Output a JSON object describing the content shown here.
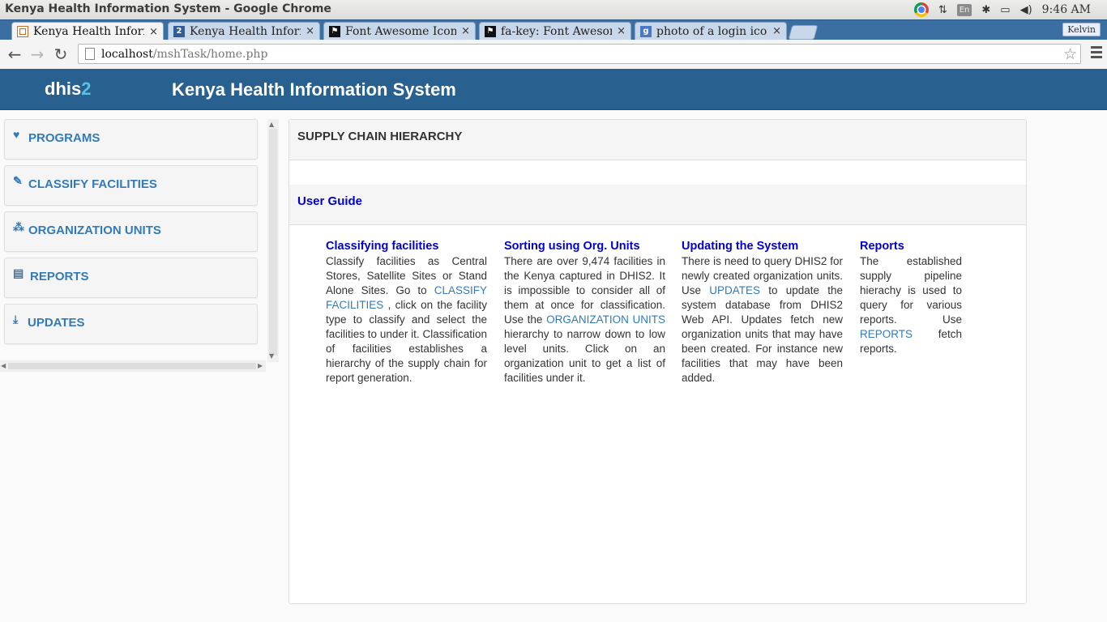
{
  "os": {
    "window_title": "Kenya Health Information System - Google Chrome",
    "lang": "En",
    "clock": "9:46 AM"
  },
  "browser": {
    "tabs": [
      {
        "label": "Kenya Health Informatio",
        "favicon": "dhis-icon",
        "active": true
      },
      {
        "label": "Kenya Health Informatio",
        "favicon": "dhis2-icon",
        "active": false
      },
      {
        "label": "Font Awesome Icons",
        "favicon": "flag-icon",
        "active": false
      },
      {
        "label": "fa-key: Font Awesome Ic",
        "favicon": "flag-icon",
        "active": false
      },
      {
        "label": "photo of a login icon - G",
        "favicon": "google-icon",
        "active": false
      }
    ],
    "profile": "Kelvin",
    "url_host": "localhost",
    "url_path": "/mshTask/home.php"
  },
  "header": {
    "brand_text": "dhis",
    "brand_num": "2",
    "title": "Kenya Health Information System"
  },
  "sidebar": {
    "items": [
      {
        "label": "PROGRAMS",
        "icon": "heartbeat-icon"
      },
      {
        "label": "CLASSIFY FACILITIES",
        "icon": "edit-icon"
      },
      {
        "label": "ORGANIZATION UNITS",
        "icon": "sitemap-icon"
      },
      {
        "label": "REPORTS",
        "icon": "newspaper-icon"
      },
      {
        "label": "UPDATES",
        "icon": "download-icon"
      }
    ]
  },
  "main": {
    "heading": "SUPPLY CHAIN HIERARCHY",
    "guide_heading": "User Guide",
    "columns": [
      {
        "title": "Classifying facilities",
        "t1": "Classify facilities as Central Stores, Satellite Sites or Stand Alone Sites. Go to ",
        "link": "CLASSIFY FACILITIES",
        "t2": " , click on the facility type to classify and select the facilities to under it. Classification of facilities establishes a hierarchy of the supply chain for report generation."
      },
      {
        "title": "Sorting using Org. Units",
        "t1": "There are over 9,474 facilities in the Kenya captured in DHIS2. It is impossible to consider all of them at once for classification. Use the ",
        "link": "ORGANIZATION UNITS",
        "t2": " hierarchy to narrow down to low level units. Click on an organization unit to get a list of facilities under it."
      },
      {
        "title": "Updating the System",
        "t1": "There is need to query DHIS2 for newly created organization units. Use ",
        "link": "UPDATES",
        "t2": " to update the system database from DHIS2 Web API. Updates fetch new organization units that may have been created. For instance new facilities that may have been added."
      },
      {
        "title": "Reports",
        "t1": "The established supply pipeline hierachy is used to query for various reports. Use ",
        "link": "REPORTS",
        "t2": " fetch reports."
      }
    ]
  },
  "colors": {
    "header_bg": "#286090",
    "accent": "#337ab7",
    "guide_title": "#0000cc"
  }
}
